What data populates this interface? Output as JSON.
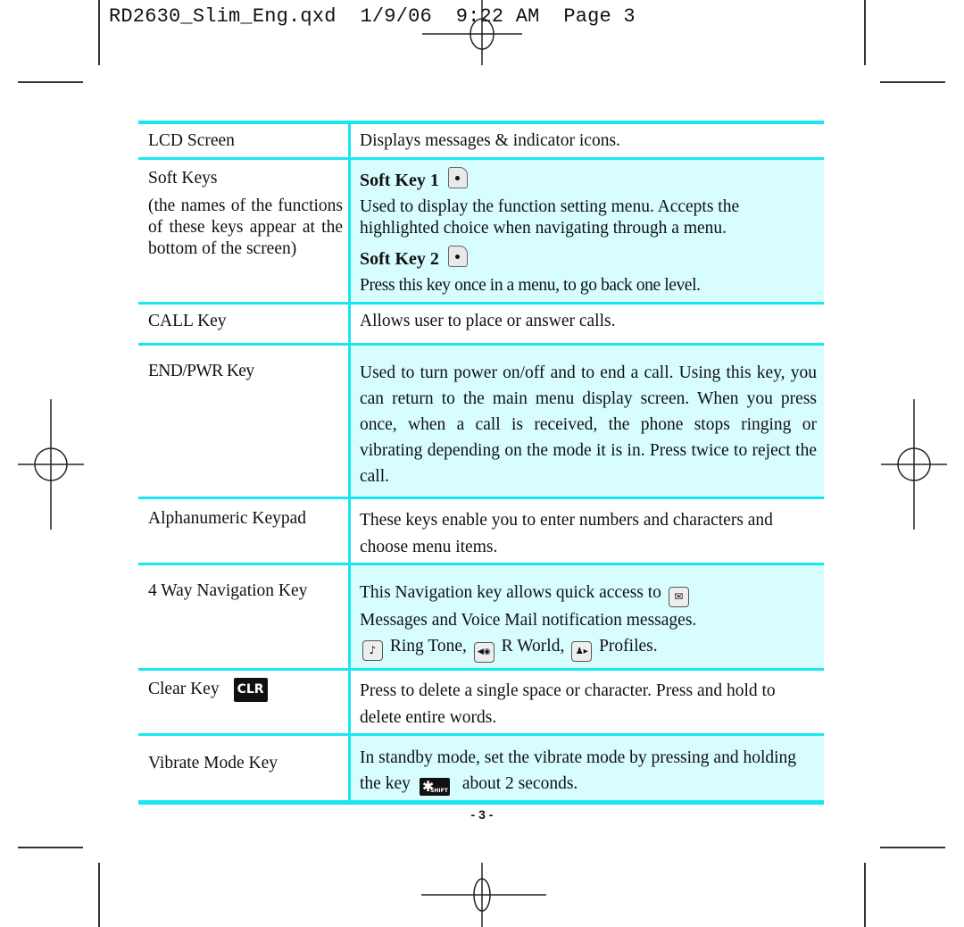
{
  "slug": {
    "filename": "RD2630_Slim_Eng.qxd",
    "date": "1/9/06",
    "time": "9:22 AM",
    "page_label": "Page 3"
  },
  "colors": {
    "rule": "#18e6f0",
    "row_fill": "#d7fdff"
  },
  "table": {
    "rows": [
      {
        "name": "LCD Screen",
        "description": "Displays messages & indicator icons."
      },
      {
        "name": "Soft Keys",
        "name_note": "(the names of the functions of these keys appear at the bottom of the screen)",
        "soft_key_1": {
          "title": "Soft Key 1",
          "icon": "soft-key-left-icon",
          "text": "Used to display the function setting menu. Accepts the highlighted choice when navigating through a menu."
        },
        "soft_key_2": {
          "title": "Soft Key 2",
          "icon": "soft-key-right-icon",
          "text": "Press this key once in a menu, to go back one level."
        }
      },
      {
        "name": "CALL Key",
        "description": "Allows user to place or answer calls."
      },
      {
        "name": "END/PWR Key",
        "description": "Used to turn power on/off and to end a call. Using this key, you can return to the main menu display screen. When you press once, when a call is received, the phone stops ringing or vibrating depending on the mode it is in. Press twice to reject the call."
      },
      {
        "name": "Alphanumeric Keypad",
        "description": "These keys enable you to enter numbers and characters and choose menu items."
      },
      {
        "name": "4 Way Navigation Key",
        "desc_part1": "This Navigation key allows quick access to",
        "desc_part2": "Messages and Voice Mail notification messages.",
        "ring_tone": "Ring Tone,",
        "r_world": "R World,",
        "profiles": "Profiles.",
        "icons": {
          "messages": "✉",
          "ring_tone": "♪",
          "r_world": "◀◉",
          "profiles": "♟▸"
        }
      },
      {
        "name": "Clear Key",
        "key_label": "CLR",
        "description": "Press to delete a single space or character. Press and hold to delete entire words."
      },
      {
        "name": "Vibrate Mode Key",
        "desc_part1": "In standby mode, set the vibrate mode by pressing and holding the key",
        "key_glyph": "✱",
        "key_sub": "SHIFT",
        "desc_part2": "about 2 seconds."
      }
    ]
  },
  "footer": {
    "page_number": "- 3 -"
  }
}
